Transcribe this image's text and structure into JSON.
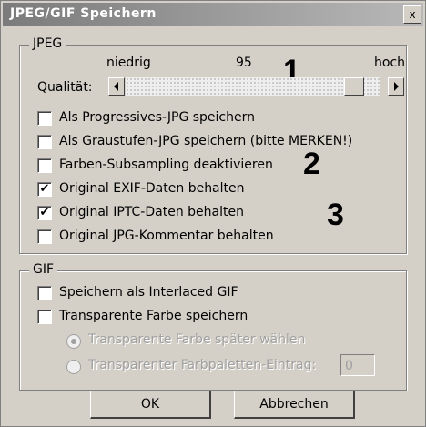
{
  "window": {
    "title": "JPEG/GIF Speichern",
    "close_label": "x"
  },
  "jpeg": {
    "legend": "JPEG",
    "low_label": "niedrig",
    "quality_value": "95",
    "high_label": "hoch",
    "quality_label": "Qualität:",
    "quality_level": 0.93,
    "options": [
      {
        "label": "Als Progressives-JPG speichern",
        "checked": false
      },
      {
        "label": "Als Graustufen-JPG speichern (bitte MERKEN!)",
        "checked": false
      },
      {
        "label": "Farben-Subsampling deaktivieren",
        "checked": false
      },
      {
        "label": "Original EXIF-Daten behalten",
        "checked": true
      },
      {
        "label": "Original IPTC-Daten behalten",
        "checked": true
      },
      {
        "label": "Original JPG-Kommentar behalten",
        "checked": false
      }
    ]
  },
  "gif": {
    "legend": "GIF",
    "options": [
      {
        "label": "Speichern als Interlaced GIF",
        "checked": false
      },
      {
        "label": "Transparente Farbe speichern",
        "checked": false
      }
    ],
    "radio_later": "Transparente Farbe später wählen",
    "radio_palette": "Transparenter Farbpaletten-Eintrag:",
    "palette_value": "0"
  },
  "annotations": {
    "one": "1",
    "two": "2",
    "three": "3"
  },
  "buttons": {
    "ok": "OK",
    "cancel": "Abbrechen"
  },
  "icons": {
    "left_arrow": "triangle-left",
    "right_arrow": "triangle-right",
    "check": "✔"
  }
}
